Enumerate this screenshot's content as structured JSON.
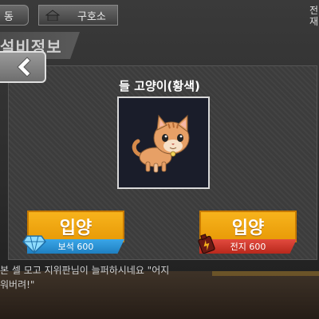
{
  "top_bar": {
    "tab_dong": "동",
    "tab_shelter": "구호소",
    "right_text_line1": "전",
    "right_text_line2": "재"
  },
  "section": {
    "title": "설비정보"
  },
  "dialog": {
    "title": "들 고양이(황색)",
    "pet_icon": "yellow-cat"
  },
  "buttons": {
    "adopt_gem": {
      "label": "입양",
      "price": "보석 600",
      "icon": "gem-icon"
    },
    "adopt_battery": {
      "label": "입양",
      "price": "전지 600",
      "icon": "battery-icon"
    }
  },
  "dialogue": {
    "line1": "본 셀 모고 지위판님이 늘퍼하시네요 \"어지",
    "line2": "워버려!\""
  },
  "colors": {
    "button_orange": "#f7b31c",
    "gem_blue": "#3aa6e8",
    "battery_red": "#e24b3e"
  }
}
